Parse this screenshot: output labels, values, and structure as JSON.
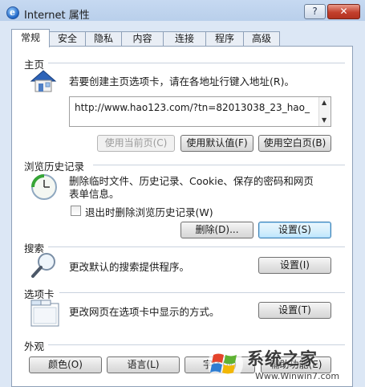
{
  "window": {
    "title": "Internet 属性",
    "help_label": "?",
    "close_label": "✕"
  },
  "tabs": [
    {
      "label": "常规",
      "active": true
    },
    {
      "label": "安全"
    },
    {
      "label": "隐私"
    },
    {
      "label": "内容"
    },
    {
      "label": "连接"
    },
    {
      "label": "程序"
    },
    {
      "label": "高级"
    }
  ],
  "homepage": {
    "heading": "主页",
    "instruction": "若要创建主页选项卡，请在各地址行键入地址(R)。",
    "url": "http://www.hao123.com/?tn=82013038_23_hao_",
    "use_current_label": "使用当前页(C)",
    "use_default_label": "使用默认值(F)",
    "use_blank_label": "使用空白页(B)"
  },
  "history": {
    "heading": "浏览历史记录",
    "description_line1": "删除临时文件、历史记录、Cookie、保存的密码和网页",
    "description_line2": "表单信息。",
    "checkbox_label": "退出时删除浏览历史记录(W)",
    "checkbox_checked": false,
    "delete_label": "删除(D)...",
    "settings_label": "设置(S)"
  },
  "search": {
    "heading": "搜索",
    "description": "更改默认的搜索提供程序。",
    "settings_label": "设置(I)"
  },
  "tabs_section": {
    "heading": "选项卡",
    "description": "更改网页在选项卡中显示的方式。",
    "settings_label": "设置(T)"
  },
  "appearance": {
    "heading": "外观",
    "colors_label": "颜色(O)",
    "languages_label": "语言(L)",
    "fonts_label": "字体(N)",
    "accessibility_label": "辅助功能(E)"
  },
  "watermark": {
    "brand": "系统之家",
    "site": "Www.Winwin7.com"
  },
  "colors": {
    "focus_border": "#3c7fb1",
    "close_red": "#c3402d"
  }
}
